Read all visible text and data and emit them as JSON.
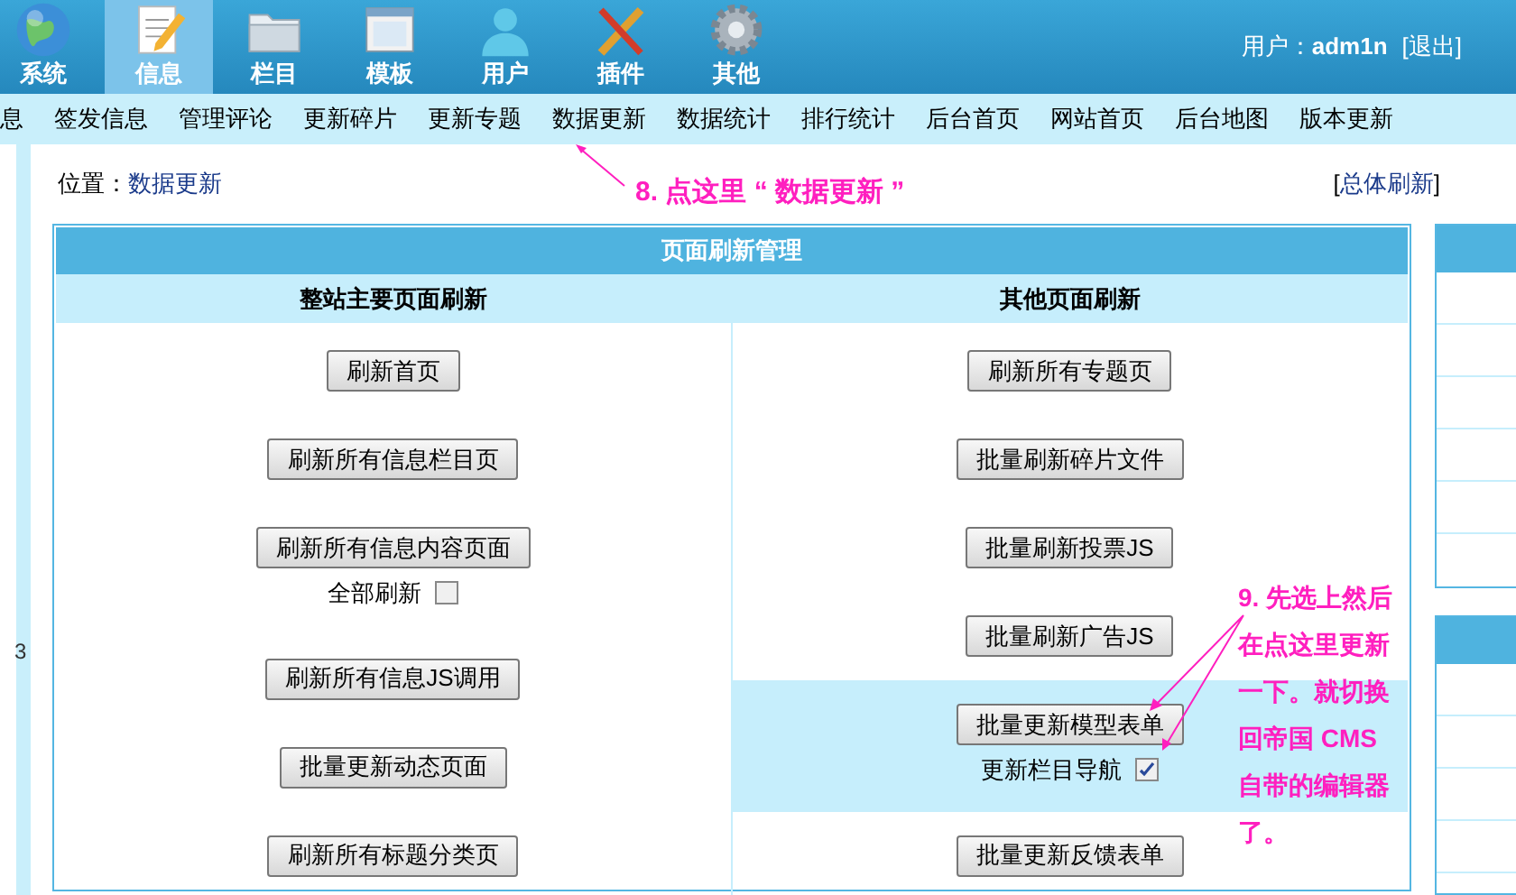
{
  "top_nav": [
    {
      "label": "系统",
      "selected": false
    },
    {
      "label": "信息",
      "selected": true
    },
    {
      "label": "栏目",
      "selected": false
    },
    {
      "label": "模板",
      "selected": false
    },
    {
      "label": "用户",
      "selected": false
    },
    {
      "label": "插件",
      "selected": false
    },
    {
      "label": "其他",
      "selected": false
    }
  ],
  "user": {
    "label": "用户：",
    "name": "adm1n",
    "logout": "[退出]"
  },
  "sub_nav": [
    "息",
    "签发信息",
    "管理评论",
    "更新碎片",
    "更新专题",
    "数据更新",
    "数据统计",
    "排行统计",
    "后台首页",
    "网站首页",
    "后台地图",
    "版本更新"
  ],
  "side_marker": "3",
  "breadcrumb": {
    "label": "位置：",
    "current": "数据更新"
  },
  "refresh_all": {
    "open": "[",
    "label": "总体刷新",
    "close": "]"
  },
  "panel": {
    "title": "页面刷新管理",
    "columns": [
      {
        "heading": "整站主要页面刷新",
        "groups": [
          {
            "highlighted": false,
            "button": "刷新首页"
          },
          {
            "highlighted": false,
            "button": "刷新所有信息栏目页"
          },
          {
            "highlighted": false,
            "button": "刷新所有信息内容页面",
            "checkbox": {
              "label": "全部刷新",
              "checked": false
            }
          },
          {
            "highlighted": false,
            "button": "刷新所有信息JS调用"
          },
          {
            "highlighted": false,
            "button": "批量更新动态页面"
          },
          {
            "highlighted": false,
            "button": "刷新所有标题分类页"
          }
        ]
      },
      {
        "heading": "其他页面刷新",
        "groups": [
          {
            "highlighted": false,
            "button": "刷新所有专题页"
          },
          {
            "highlighted": false,
            "button": "批量刷新碎片文件"
          },
          {
            "highlighted": false,
            "button": "批量刷新投票JS"
          },
          {
            "highlighted": false,
            "button": "批量刷新广告JS"
          },
          {
            "highlighted": true,
            "button": "批量更新模型表单",
            "checkbox": {
              "label": "更新栏目导航",
              "checked": true
            }
          },
          {
            "highlighted": false,
            "button": "批量更新反馈表单"
          }
        ]
      }
    ]
  },
  "annotations": [
    {
      "text": "8. 点这里 “ 数据更新 ”"
    },
    {
      "text": "9. 先选上然后在点这里更新一下。就切换回帝国 CMS 自带的编辑器了。"
    }
  ]
}
